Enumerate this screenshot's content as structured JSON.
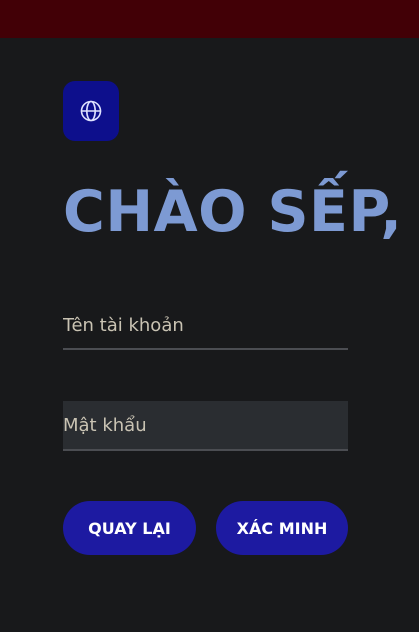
{
  "header": {
    "bar_color": "#420006"
  },
  "language_button": {
    "icon": "globe-icon",
    "color": "#0d0f8c"
  },
  "greeting": {
    "title": "CHÀO SẾP,"
  },
  "form": {
    "username_placeholder": "Tên tài khoản",
    "username_value": "",
    "password_placeholder": "Mật khẩu",
    "password_value": ""
  },
  "actions": {
    "back_label": "QUAY LẠI",
    "verify_label": "XÁC MINH",
    "button_color": "#1d1aa1"
  },
  "colors": {
    "background": "#18191b",
    "accent_text": "#7d9ad3",
    "field_text": "#c9c3b3"
  }
}
